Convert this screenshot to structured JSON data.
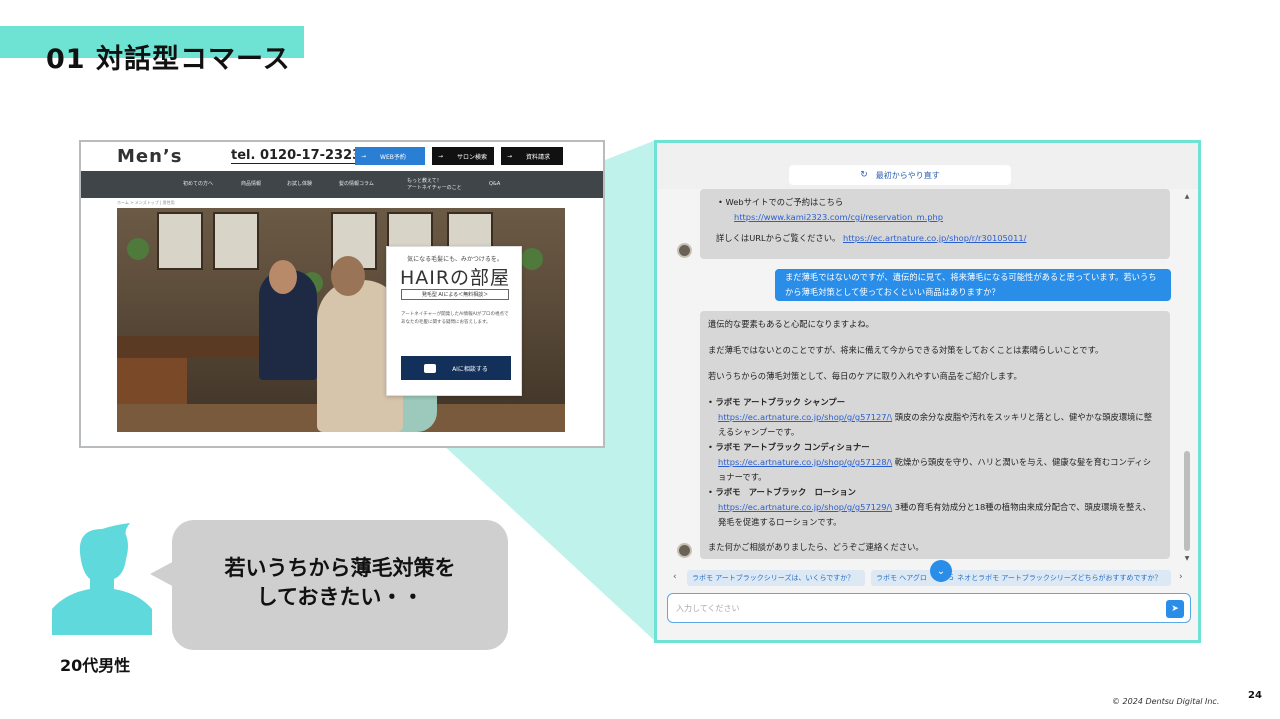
{
  "slide": {
    "title": "01 対話型コマース",
    "accent_color": "#6fe3d3",
    "page_number": "24",
    "copyright": "© 2024 Dentsu Digital Inc."
  },
  "website": {
    "logo": "Men’s",
    "tel": "tel. 0120-17-2323",
    "buttons": [
      "WEB予約",
      "サロン検索",
      "資料請求"
    ],
    "nav": [
      "初めての方へ",
      "商品情報",
      "お試し体験",
      "髪の情報コラム",
      "もっと教えて！\nアートネイチャーのこと",
      "Q&A"
    ],
    "breadcrumb": "ホーム  >  メンズトップ | 男性用",
    "card": {
      "tagline": "気になる毛髪にも、みかつけるを。",
      "title": "HAIRの部屋",
      "subtitle": "発毛型 AIによる＜無料相談＞",
      "body": "アートネイチャーが開発したAI情報AIがプロの視点であなたの毛髪に関する疑問にお答えします。",
      "cta": "AIに相談する"
    }
  },
  "chat": {
    "restart_label": "最初からやり直す",
    "msg1": {
      "bullet": "Webサイトでのご予約はこちら",
      "bullet_link": "https://www.kami2323.com/cgi/reservation_m.php",
      "text": "詳しくはURLからご覧ください。",
      "link": "https://ec.artnature.co.jp/shop/r/r30105011/"
    },
    "user_msg": "まだ薄毛ではないのですが、遺伝的に見て、将来薄毛になる可能性があると思っています。若いうちから薄毛対策として使っておくといい商品はありますか？",
    "msg2": {
      "p1": "遺伝的な要素もあると心配になりますよね。",
      "p2": "まだ薄毛ではないとのことですが、将来に備えて今からできる対策をしておくことは素晴らしいことです。",
      "p3": "若いうちからの薄毛対策として、毎日のケアに取り入れやすい商品をご紹介します。",
      "items": [
        {
          "name": "ラボモ アートブラック シャンプー",
          "link": "https://ec.artnature.co.jp/shop/g/g57127/\\",
          "desc": "頭皮の余分な皮脂や汚れをスッキリと落とし、健やかな頭皮環境に整えるシャンプーです。"
        },
        {
          "name": "ラボモ アートブラック コンディショナー",
          "link": "https://ec.artnature.co.jp/shop/g/g57128/\\",
          "desc": "乾燥から頭皮を守り、ハリと潤いを与え、健康な髪を育むコンディショナーです。"
        },
        {
          "name": "ラボモ　アートブラック　ローション",
          "link": "https://ec.artnature.co.jp/shop/g/g57129/\\",
          "desc": "3種の育毛有効成分と18種の植物由来成分配合で、頭皮環境を整え、発毛を促進するローションです。"
        }
      ],
      "closing": "また何かご相談がありましたら、どうぞご連絡ください。"
    },
    "suggestions": [
      "ラボモ アートブラックシリーズは、いくらですか？",
      "ラボモ ヘアグロ　キシ５ ネオとラボモ アートブラックシリーズどちらがおすすめですか？"
    ],
    "input_placeholder": "入力してください"
  },
  "persona": {
    "speech": "若いうちから薄毛対策を\nしておきたい・・",
    "label": "20代男性"
  }
}
